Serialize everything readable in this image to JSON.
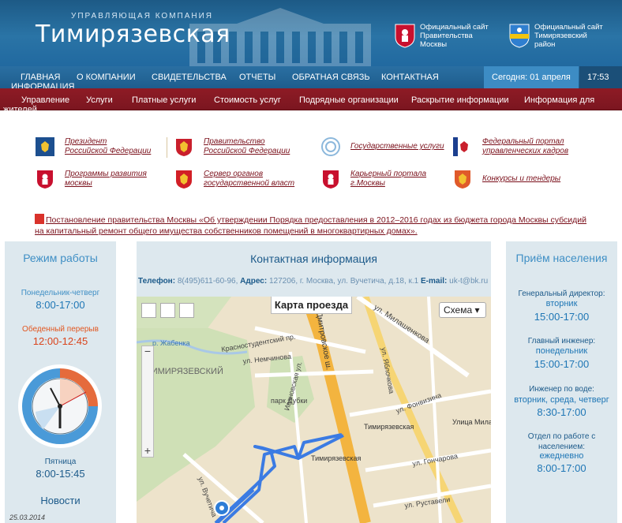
{
  "header": {
    "logo_subtitle": "УПРАВЛЯЮЩАЯ КОМПАНИЯ",
    "logo_title": "Тимирязевская",
    "links": [
      {
        "label": "Официальный сайт Правительства Москвы",
        "icon": "moscow-coat-of-arms-icon"
      },
      {
        "label": "Официальный сайт Тимирязевский район",
        "icon": "district-emblem-icon"
      }
    ]
  },
  "main_nav": {
    "items": [
      "ГЛАВНАЯ",
      "О КОМПАНИИ",
      "СВИДЕТЕЛЬСТВА",
      "ОТЧЕТЫ",
      "ОБРАТНАЯ СВЯЗЬ",
      "КОНТАКТНАЯ"
    ],
    "item0_line2": "ИНФОРМАЦИЯ",
    "date": "Сегодня: 01 апреля",
    "time": "17:53"
  },
  "sub_nav": {
    "items": [
      "Управление",
      "Услуги",
      "Платные услуги",
      "Стоимость услуг",
      "Подрядные организации",
      "Раскрытие информации",
      "Информация для"
    ],
    "line2": "жителей"
  },
  "links": [
    {
      "label": "Президент Российской Федерации",
      "icon": "russia-eagle-icon"
    },
    {
      "label": "Правительство Российской Федерации",
      "icon": "russia-coat-of-arms-icon"
    },
    {
      "label": "Государственные услуги",
      "icon": "gosuslugi-icon"
    },
    {
      "label": "Федеральный портал управленческих кадров",
      "icon": "russia-flag-eagle-icon"
    },
    {
      "label": "Программы развития москвы",
      "icon": "moscow-shield-icon"
    },
    {
      "label": "Сервер органов государственной власт",
      "icon": "russia-red-shield-icon"
    },
    {
      "label": "Карьерный портала г.Москвы",
      "icon": "moscow-shield-icon"
    },
    {
      "label": "Конкурсы и тендеры",
      "icon": "russia-red-shield-icon"
    }
  ],
  "notice": {
    "text": "Постановление правительства Москвы «Об утверждении Порядка предоставления в 2012–2016 годах из бюджета города Москвы субсидий на капитальный ремонт общего имущества собственников помещений в многоквартирных домах».",
    "icon": "pdf-icon"
  },
  "schedule": {
    "title": "Режим работы",
    "rows": [
      {
        "label": "Понедельник-четверг",
        "value": "8:00-17:00"
      },
      {
        "label": "Обеденный перерыв",
        "value": "12:00-12:45"
      },
      {
        "label": "Пятница",
        "value": "8:00-15:45"
      }
    ],
    "clock_icon": "analog-clock-icon",
    "news_title": "Новости",
    "news_date": "25.03.2014"
  },
  "contact": {
    "title": "Контактная информация",
    "phone_label": "Телефон:",
    "phone": "8(495)611-60-96,",
    "address_label": "Адрес:",
    "address": "127206, г. Москва, ул. Вучетича, д.18, к.1",
    "email_label": "E-mail:",
    "email": "uk-t@bk.ru"
  },
  "map": {
    "title": "Карта проезда",
    "scheme_button": "Схема",
    "labels": {
      "district": "ТИМИРЯЗЕВСКИЙ",
      "zhabenka": "р. Жабенка",
      "krasnostud": "Краснос­тудентский пр.",
      "nemchinova": "ул. Немчинова",
      "park": "парк Дубки",
      "ivanovskaya": "Ивановская ул.",
      "metro1": "Тимирязевская",
      "metro2": "Тимирязевская",
      "milashenkova": "ул. Милашенкова",
      "yablochkova": "ул. Яблочкова",
      "street_milash": "Улица Милашенкова",
      "fonvizina": "ул. Фонвизина",
      "goncharova": "ул. Гончарова",
      "rustaveli": "ул. Руставели",
      "vuchetich": "ул. Вучетича",
      "dmitrovskoe": "Дмитровское ш."
    }
  },
  "reception": {
    "title": "Приём населения",
    "rows": [
      {
        "label": "Генеральный директор:",
        "day": "вторник",
        "time": "15:00-17:00"
      },
      {
        "label": "Главный инженер:",
        "day": "понедельник",
        "time": "15:00-17:00"
      },
      {
        "label": "Инженер по воде:",
        "day": "вторник, среда, четверг",
        "time": "8:30-17:00"
      },
      {
        "label": "Отдел по работе с населением:",
        "day": "ежедневно",
        "time": "8:00-17:00"
      }
    ]
  }
}
